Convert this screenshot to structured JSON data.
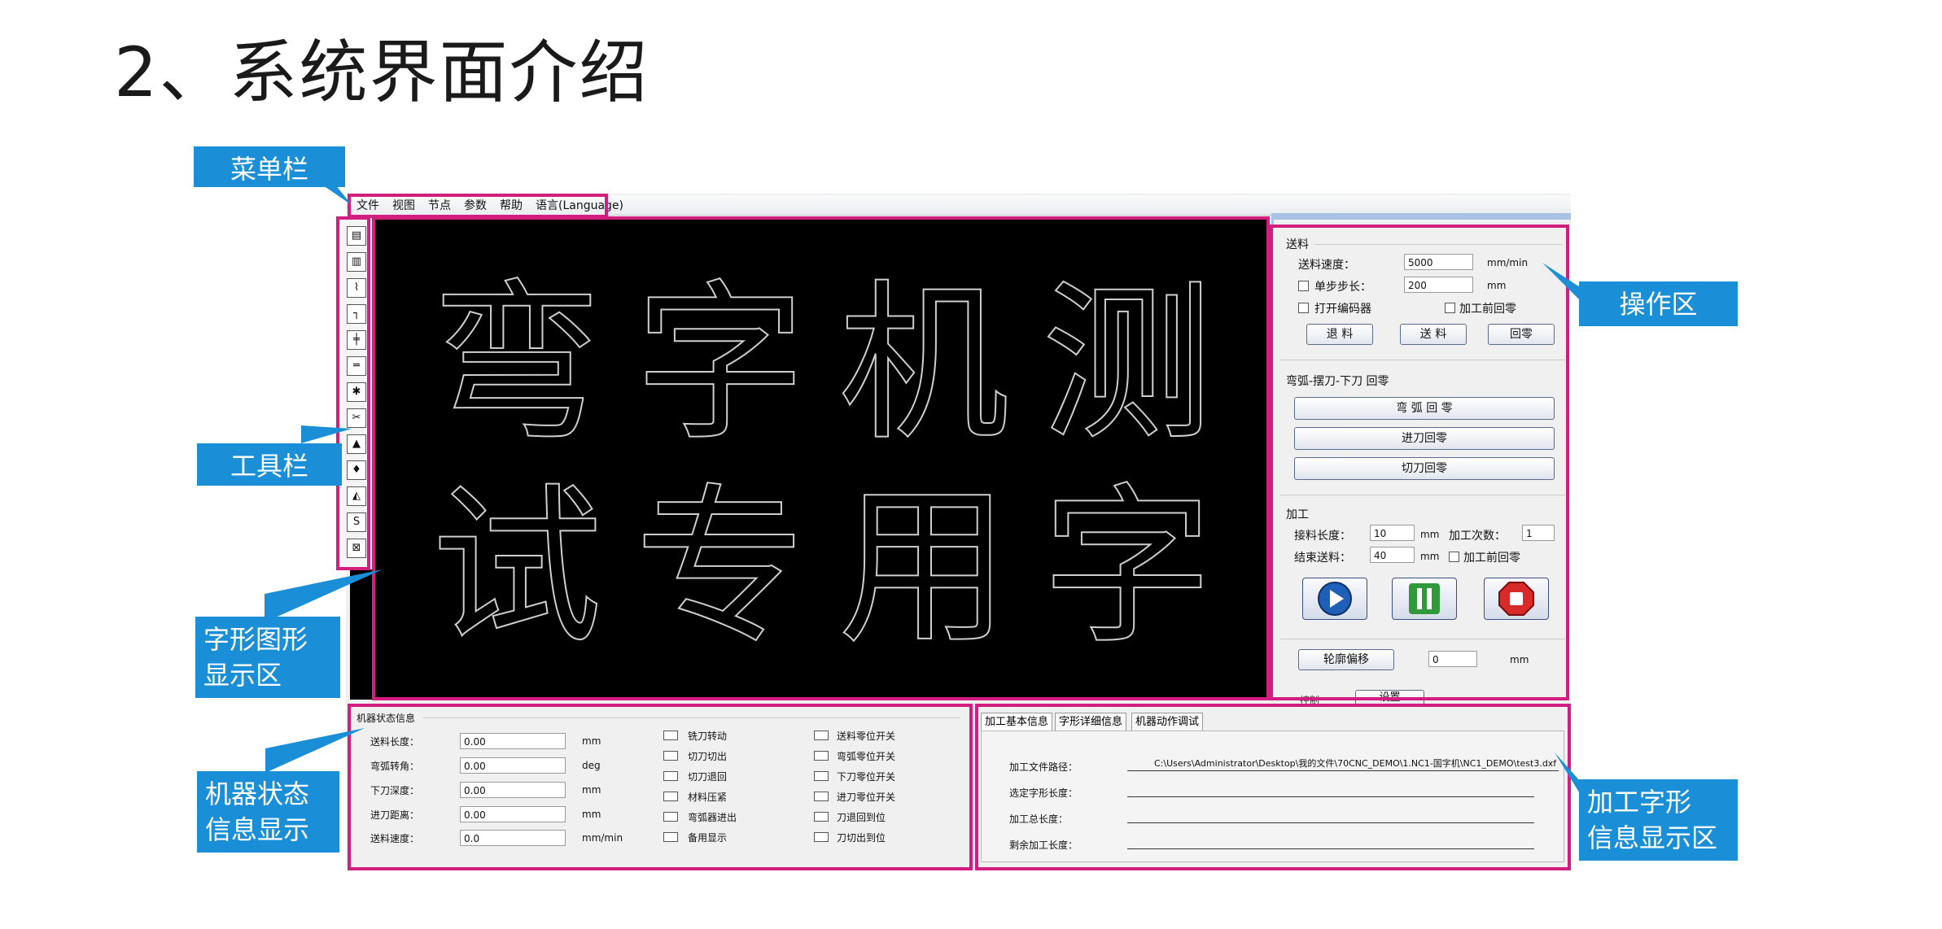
{
  "slide": {
    "title": "2、系统界面介绍"
  },
  "menu": [
    "文件",
    "视图",
    "节点",
    "参数",
    "帮助",
    "语言(Language)"
  ],
  "toolbar": {
    "icons": [
      "open-folder-icon",
      "open-file-icon",
      "node-path-icon",
      "corner-icon",
      "align-center-icon",
      "align-horizontal-icon",
      "gear-cut-icon",
      "scissors-icon",
      "image-icon",
      "flip-vertical-icon",
      "mirror-icon",
      "s-box-icon",
      "close-box-icon"
    ]
  },
  "canvas": {
    "line1": "弯字机测",
    "line2": "试专用字"
  },
  "control": {
    "feed": {
      "group": "送料",
      "speed_label": "送料速度：",
      "speed_value": "5000",
      "speed_unit": "mm/min",
      "step_label": "单步步长：",
      "step_value": "200",
      "step_unit": "mm",
      "encoder_label": "打开编码器",
      "home_before_label": "加工前回零",
      "back_btn": "退 料",
      "feed_btn": "送 料",
      "home_btn": "回零"
    },
    "arc": {
      "group": "弯弧-摆刀-下刀 回零",
      "arc_home": "弯 弧 回 零",
      "feed_knife_home": "进刀回零",
      "cut_knife_home": "切刀回零"
    },
    "process": {
      "group": "加工",
      "splice_label": "接料长度：",
      "splice_value": "10",
      "splice_unit": "mm",
      "count_label": "加工次数：",
      "count_value": "1",
      "end_label": "结束送料：",
      "end_value": "40",
      "end_unit": "mm",
      "home_before_label": "加工前回零"
    },
    "offset": {
      "btn": "轮廓偏移",
      "value": "0",
      "unit": "mm"
    },
    "bottom": {
      "ctrl_label": "控制",
      "set_btn": "设置"
    }
  },
  "status": {
    "group": "机器状态信息",
    "fields": [
      {
        "label": "送料长度：",
        "value": "0.00",
        "unit": "mm"
      },
      {
        "label": "弯弧转角：",
        "value": "0.00",
        "unit": "deg"
      },
      {
        "label": "下刀深度：",
        "value": "0.00",
        "unit": "mm"
      },
      {
        "label": "进刀距离：",
        "value": "0.00",
        "unit": "mm"
      },
      {
        "label": "送料速度：",
        "value": "0.0",
        "unit": "mm/min"
      }
    ],
    "checks_a": [
      "铣刀转动",
      "切刀切出",
      "切刀退回",
      "材料压紧",
      "弯弧器进出",
      "备用显示"
    ],
    "checks_b": [
      "送料零位开关",
      "弯弧零位开关",
      "下刀零位开关",
      "进刀零位开关",
      "刀退回到位",
      "刀切出到位"
    ]
  },
  "info": {
    "tabs": [
      "加工基本信息",
      "字形详细信息",
      "机器动作调试"
    ],
    "rows": [
      {
        "label": "加工文件路径：",
        "value": "C:\\Users\\Administrator\\Desktop\\我的文件\\70CNC_DEMO\\1.NC1-国字机\\NC1_DEMO\\test3.dxf"
      },
      {
        "label": "选定字形长度：",
        "value": ""
      },
      {
        "label": "加工总长度：",
        "value": ""
      },
      {
        "label": "剩余加工长度：",
        "value": ""
      }
    ]
  },
  "callouts": {
    "menubar": "菜单栏",
    "toolbar": "工具栏",
    "canvas_1": "字形图形",
    "canvas_2": "显示区",
    "status_1": "机器状态",
    "status_2": "信息显示区",
    "operation": "操作区",
    "info_1": "加工字形",
    "info_2": "信息显示区"
  },
  "colors": {
    "frame": "#d31e7f",
    "callout": "#1a8fd8",
    "canvas_bg": "#000000",
    "glyph_stroke": "#cfcfcf"
  }
}
